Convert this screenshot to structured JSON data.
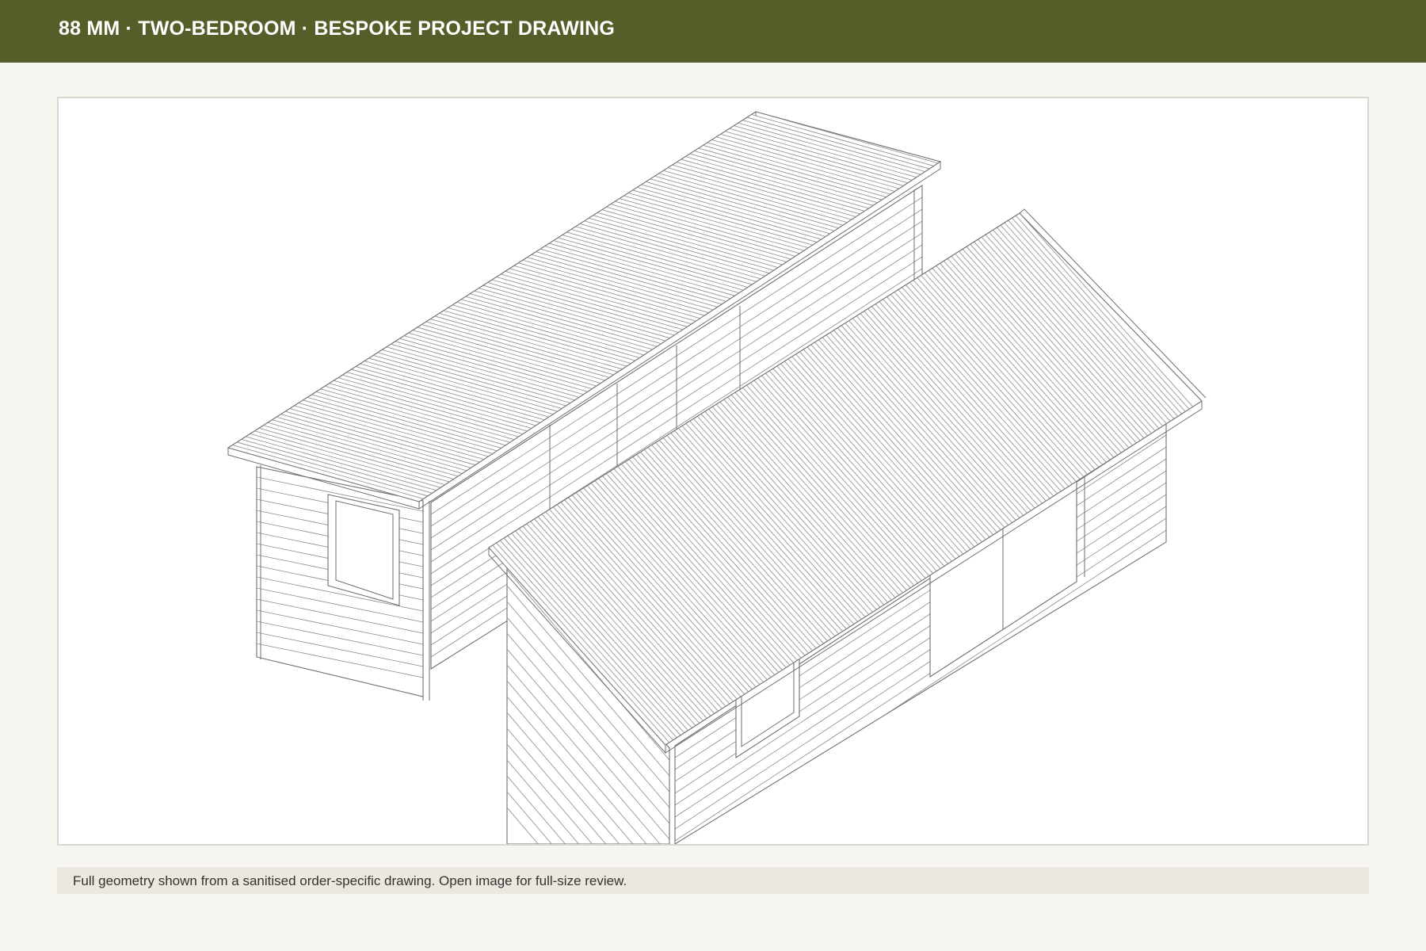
{
  "header": {
    "title": "88 MM · TWO-BEDROOM · BESPOKE PROJECT DRAWING",
    "background_color": "#545e28"
  },
  "drawing": {
    "icon": "isometric-cabin-drawing",
    "line_color": "#6f6f6f"
  },
  "caption": {
    "text": "Full geometry shown from a sanitised order-specific drawing. Open image for full-size review."
  }
}
